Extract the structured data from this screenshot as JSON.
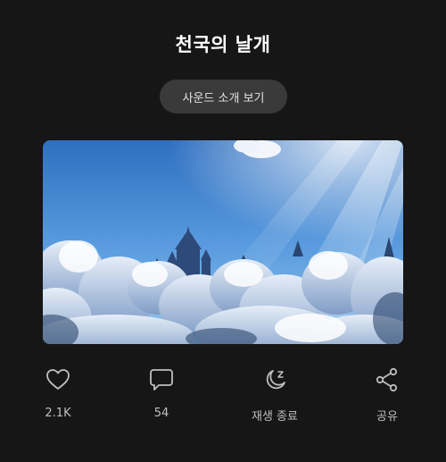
{
  "header": {
    "title": "천국의 날개"
  },
  "intro_button": {
    "label": "사운드 소개 보기"
  },
  "artwork": {
    "description_icon": "sky-castle-artwork"
  },
  "actions": [
    {
      "icon": "heart-icon",
      "label": "2.1K"
    },
    {
      "icon": "comment-icon",
      "label": "54"
    },
    {
      "icon": "sleep-moon-icon",
      "label": "재생 종료"
    },
    {
      "icon": "share-icon",
      "label": "공유"
    }
  ],
  "colors": {
    "background": "#161616",
    "button_bg": "#3a3a3a",
    "icon_stroke": "#bfbfbf",
    "title": "#ffffff"
  }
}
